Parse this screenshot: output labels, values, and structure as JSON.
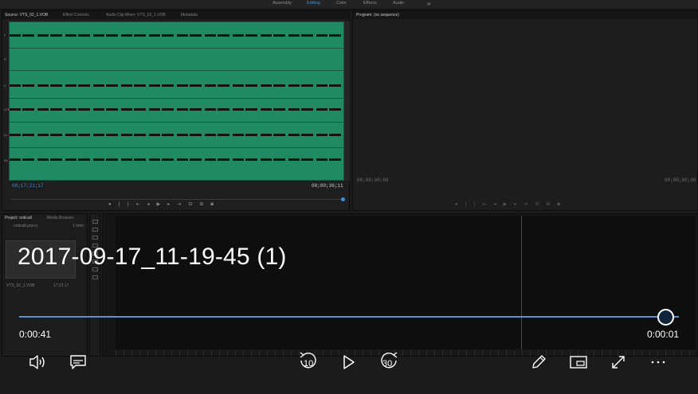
{
  "editor": {
    "workspace_tabs": [
      "Assembly",
      "Editing",
      "Color",
      "Effects",
      "Audio"
    ],
    "active_workspace": "Editing",
    "source_panel": {
      "tabs": [
        "Source: VTS_02_1.VOB",
        "Effect Controls",
        "Audio Clip Mixer: VTS_02_1.VOB",
        "Metadata"
      ],
      "channel_labels": [
        "L",
        "R",
        "C",
        "LFE",
        "Ls",
        "Rs"
      ],
      "timecode_in": "00;17;21;17",
      "timecode_duration": "00;00;36;11"
    },
    "program_panel": {
      "title": "Program: (no sequence)",
      "timecode_left": "00;00;00;00",
      "timecode_right": "00;00;00;00"
    },
    "project_panel": {
      "tabs": [
        "Project: noticall",
        "Media Browser"
      ],
      "project_file": "noticall.prproj",
      "item_count": "1 Item",
      "clip_name": "VTS_02_1.VOB",
      "clip_duration": "17;21;17"
    }
  },
  "player": {
    "title": "2017-09-17_11-19-45 (1)",
    "time_elapsed": "0:00:41",
    "time_remaining": "0:00:01",
    "progress_fraction": 0.98,
    "skip_back_seconds": "10",
    "skip_forward_seconds": "30",
    "accent_color": "#5a8fd0",
    "icons": [
      "volume-icon",
      "captions-icon",
      "skip-back-icon",
      "play-icon",
      "skip-forward-icon",
      "edit-pen-icon",
      "mini-view-icon",
      "fullscreen-icon",
      "more-icon"
    ]
  }
}
